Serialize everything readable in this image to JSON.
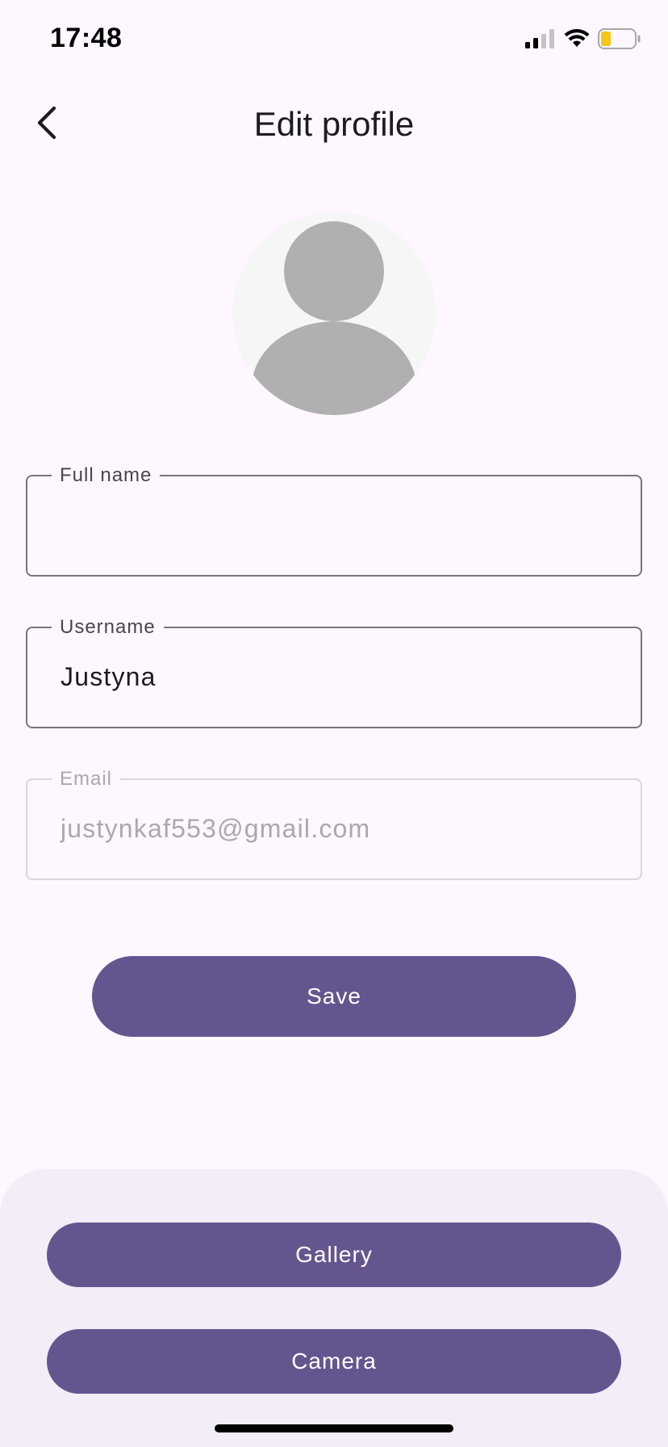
{
  "status_bar": {
    "time": "17:48",
    "icons": [
      "cellular-signal-icon",
      "wifi-icon",
      "battery-low-icon"
    ],
    "battery_color": "#f5c518"
  },
  "header": {
    "title": "Edit profile",
    "back_icon": "chevron-left-icon"
  },
  "avatar": {
    "icon": "person-placeholder-icon",
    "background": "#f6f6f6",
    "figure_color": "#b0b0b0"
  },
  "form": {
    "full_name": {
      "label": "Full name",
      "value": ""
    },
    "username": {
      "label": "Username",
      "value": "Justyna"
    },
    "email": {
      "label": "Email",
      "value": "justynkaf553@gmail.com",
      "disabled": true
    }
  },
  "save_label": "Save",
  "bottom_sheet": {
    "gallery_label": "Gallery",
    "camera_label": "Camera"
  },
  "colors": {
    "primary": "#65558f",
    "background": "#fef7ff",
    "sheet_background": "#f3edf7",
    "outline": "#79747e"
  }
}
